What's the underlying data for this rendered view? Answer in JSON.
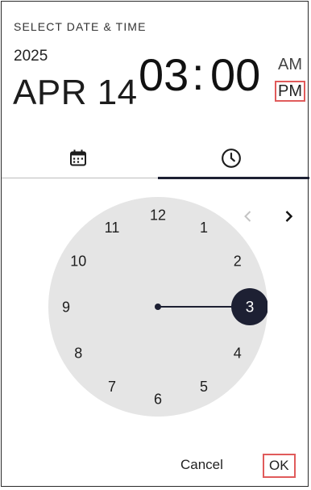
{
  "header": {
    "title": "SELECT DATE & TIME",
    "year": "2025",
    "date": "APR 14",
    "hours": "03",
    "separator": ":",
    "minutes": "00",
    "am": "AM",
    "pm": "PM"
  },
  "tabs": [
    {
      "icon": "calendar-icon",
      "selected": false
    },
    {
      "icon": "clock-icon",
      "selected": true
    }
  ],
  "clock": {
    "numbers": [
      "12",
      "1",
      "2",
      "3",
      "4",
      "5",
      "6",
      "7",
      "8",
      "9",
      "10",
      "11"
    ],
    "selected_hour": "3",
    "face_color": "#e5e5e5",
    "accent_color": "#1d2033"
  },
  "footer": {
    "cancel_label": "Cancel",
    "ok_label": "OK"
  }
}
